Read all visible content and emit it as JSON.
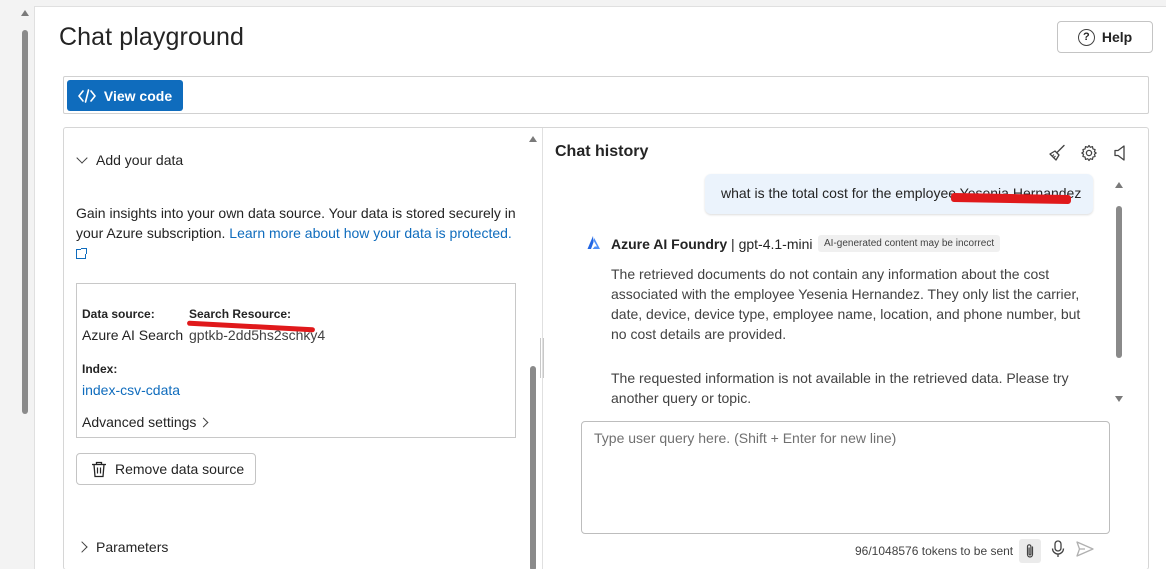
{
  "header": {
    "title": "Chat playground",
    "help_label": "Help"
  },
  "toolbar": {
    "view_code_label": "View code"
  },
  "setup": {
    "add_data_title": "Add your data",
    "description": "Gain insights into your own data source. Your data is stored securely in your Azure subscription.",
    "learn_more_link": "Learn more about how your data is protected.",
    "data_source_label": "Data source:",
    "data_source_value": "Azure AI Search",
    "search_resource_label": "Search Resource:",
    "search_resource_value": "gptkb-2dd5hs2schky4",
    "index_label": "Index:",
    "index_value": "index-csv-cdata",
    "advanced_settings_label": "Advanced settings",
    "remove_label": "Remove data source",
    "parameters_title": "Parameters"
  },
  "chat": {
    "history_title": "Chat history",
    "user_message": "what is the total cost for the employee Yesenia Hernandez",
    "assistant_name": "Azure AI Foundry",
    "assistant_model": "| gpt-4.1-mini",
    "ai_badge": "AI-generated content may be incorrect",
    "response_paragraph_1": "The retrieved documents do not contain any information about the cost associated with the employee Yesenia Hernandez. They only list the carrier, date, device, device type, employee name, location, and phone number, but no cost details are provided.",
    "response_paragraph_2": "The requested information is not available in the retrieved data. Please try another query or topic.",
    "input_placeholder": "Type user query here. (Shift + Enter for new line)",
    "token_count": "96/1048576 tokens to be sent"
  },
  "colors": {
    "accent": "#0f6cbd",
    "user_bubble": "#ebf3fc",
    "redaction": "#e0191b"
  },
  "icons": [
    "help-icon",
    "code-icon",
    "chevron-down-icon",
    "external-link-icon",
    "chevron-right-icon",
    "trash-icon",
    "broom-icon",
    "gear-icon",
    "speaker-icon",
    "azure-foundry-logo",
    "paperclip-icon",
    "microphone-icon",
    "send-icon"
  ]
}
